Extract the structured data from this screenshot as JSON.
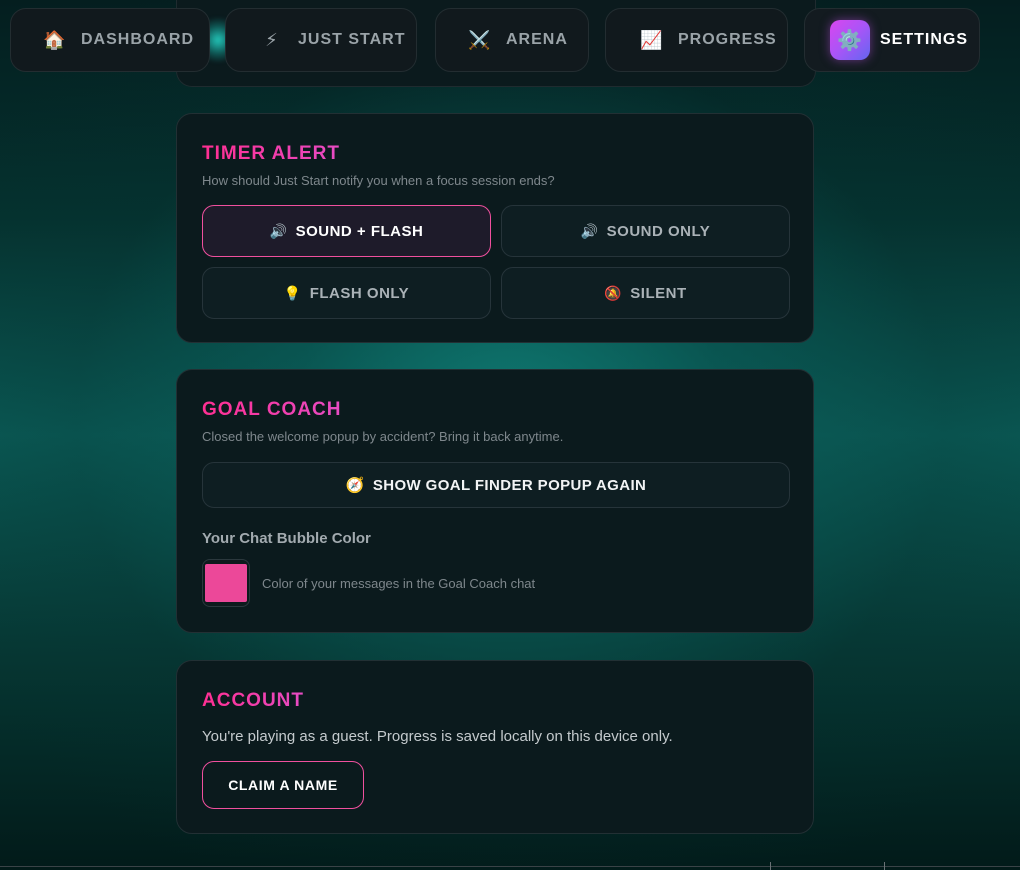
{
  "nav": {
    "tabs": [
      {
        "label": "DASHBOARD",
        "icon": "🏠",
        "icon_name": "house-icon"
      },
      {
        "label": "JUST START",
        "icon": "⚡",
        "icon_name": "lightning-icon"
      },
      {
        "label": "ARENA",
        "icon": "⚔️",
        "icon_name": "crossed-swords-icon"
      },
      {
        "label": "PROGRESS",
        "icon": "📈",
        "icon_name": "chart-increasing-icon"
      },
      {
        "label": "SETTINGS",
        "icon": "⚙️",
        "icon_name": "gear-icon",
        "active": true
      }
    ]
  },
  "timer_alert": {
    "title": "TIMER ALERT",
    "subtitle": "How should Just Start notify you when a focus session ends?",
    "options": [
      {
        "label": "SOUND + FLASH",
        "icon": "🔊",
        "icon_name": "speaker-icon",
        "selected": true
      },
      {
        "label": "SOUND ONLY",
        "icon": "🔊",
        "icon_name": "speaker-icon",
        "selected": false
      },
      {
        "label": "FLASH ONLY",
        "icon": "💡",
        "icon_name": "light-bulb-icon",
        "selected": false
      },
      {
        "label": "SILENT",
        "icon": "🔕",
        "icon_name": "bell-muted-icon",
        "selected": false
      }
    ]
  },
  "goal_coach": {
    "title": "GOAL COACH",
    "subtitle": "Closed the welcome popup by accident? Bring it back anytime.",
    "show_button": {
      "label": "SHOW GOAL FINDER POPUP AGAIN",
      "icon": "🧭",
      "icon_name": "compass-icon"
    },
    "bubble_color_label": "Your Chat Bubble Color",
    "bubble_color": "#ec4899",
    "bubble_color_desc": "Color of your messages in the Goal Coach chat"
  },
  "account": {
    "title": "ACCOUNT",
    "text": "You're playing as a guest. Progress is saved locally on this device only.",
    "claim_label": "CLAIM A NAME"
  },
  "colors": {
    "accent_pink": "#f0509e",
    "title_gradient_start": "#ff2f92",
    "title_gradient_end": "#e74cc4",
    "card_bg": "#0b1a1d",
    "teal_glow": "#26dccd"
  }
}
